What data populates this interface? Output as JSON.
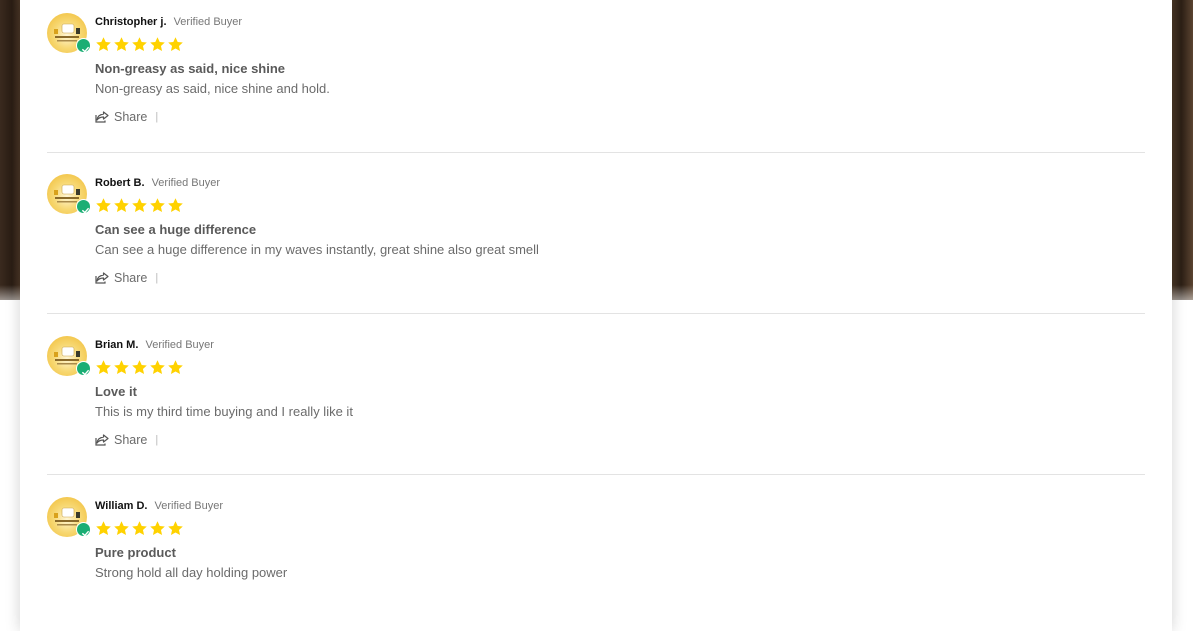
{
  "reviews": [
    {
      "author": "Christopher j.",
      "badge": "Verified Buyer",
      "rating": 5,
      "title": "Non-greasy as said, nice shine",
      "content": "Non-greasy as said, nice shine and hold.",
      "share_label": "Share",
      "separator": "|"
    },
    {
      "author": "Robert B.",
      "badge": "Verified Buyer",
      "rating": 5,
      "title": "Can see a huge difference",
      "content": "Can see a huge difference in my waves instantly, great shine also great smell",
      "share_label": "Share",
      "separator": "|"
    },
    {
      "author": "Brian M.",
      "badge": "Verified Buyer",
      "rating": 5,
      "title": "Love it",
      "content": "This is my third time buying and I really like it",
      "share_label": "Share",
      "separator": "|"
    },
    {
      "author": "William D.",
      "badge": "Verified Buyer",
      "rating": 5,
      "title": "Pure product",
      "content": "Strong hold all day holding power"
    }
  ],
  "colors": {
    "star": "#ffd200",
    "verified_check": "#1aae74",
    "divider": "#e3e3e3"
  }
}
